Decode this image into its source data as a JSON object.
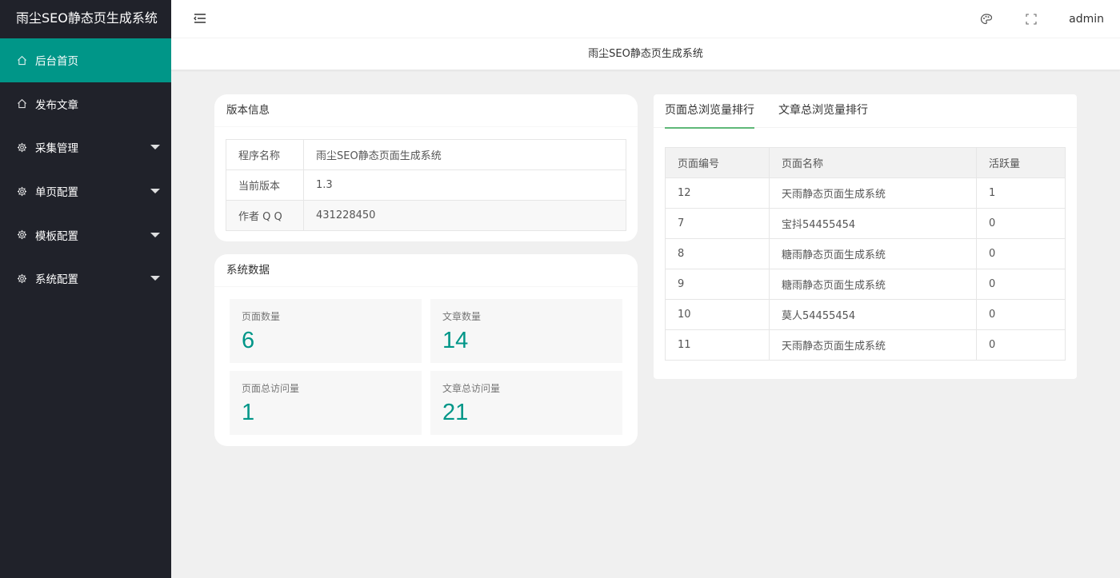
{
  "brand": "雨尘SEO静态页生成系统",
  "nav": [
    {
      "label": "后台首页",
      "active": true,
      "has_caret": false,
      "icon": "home-icon"
    },
    {
      "label": "发布文章",
      "active": false,
      "has_caret": false,
      "icon": "home-icon"
    },
    {
      "label": "采集管理",
      "active": false,
      "has_caret": true,
      "icon": "gear-icon"
    },
    {
      "label": "单页配置",
      "active": false,
      "has_caret": true,
      "icon": "gear-icon"
    },
    {
      "label": "模板配置",
      "active": false,
      "has_caret": true,
      "icon": "gear-icon"
    },
    {
      "label": "系统配置",
      "active": false,
      "has_caret": true,
      "icon": "gear-icon"
    }
  ],
  "header": {
    "user": "admin",
    "icons": [
      "fold-menu-icon",
      "palette-icon",
      "fullscreen-icon"
    ]
  },
  "page_title": "雨尘SEO静态页生成系统",
  "version_card": {
    "title": "版本信息",
    "rows": [
      {
        "key": "程序名称",
        "value": "雨尘SEO静态页面生成系统"
      },
      {
        "key": "当前版本",
        "value": "1.3"
      },
      {
        "key": "作者 Q Q",
        "value": "431228450"
      }
    ]
  },
  "data_card": {
    "title": "系统数据",
    "stats": [
      {
        "label": "页面数量",
        "value": "6"
      },
      {
        "label": "文章数量",
        "value": "14"
      },
      {
        "label": "页面总访问量",
        "value": "1"
      },
      {
        "label": "文章总访问量",
        "value": "21"
      }
    ]
  },
  "rank_card": {
    "tabs": [
      "页面总浏览量排行",
      "文章总浏览量排行"
    ],
    "active_tab": 0,
    "columns": [
      "页面编号",
      "页面名称",
      "活跃量"
    ],
    "rows": [
      [
        "12",
        "天雨静态页面生成系统",
        "1"
      ],
      [
        "7",
        "宝抖54455454",
        "0"
      ],
      [
        "8",
        "糖雨静态页面生成系统",
        "0"
      ],
      [
        "9",
        "糖雨静态页面生成系统",
        "0"
      ],
      [
        "10",
        "莫人54455454",
        "0"
      ],
      [
        "11",
        "天雨静态页面生成系统",
        "0"
      ]
    ]
  },
  "colors": {
    "accent": "#009688",
    "sidebar_bg": "#20222a",
    "tab_underline": "#5fb878"
  }
}
